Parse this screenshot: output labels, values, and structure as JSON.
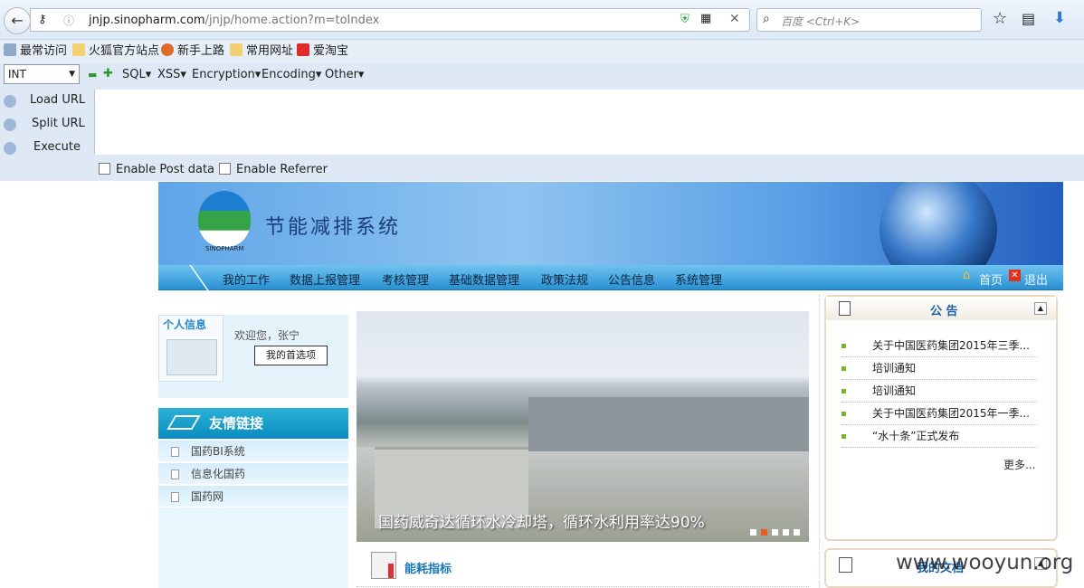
{
  "browser": {
    "url_host": "jnjp.sinopharm.com",
    "url_path": "/jnjp/home.action?m=toIndex",
    "search_placeholder": "百度 <Ctrl+K>",
    "bookmarks": [
      "最常访问",
      "火狐官方站点",
      "新手上路",
      "常用网址",
      "爱淘宝"
    ]
  },
  "hackbar": {
    "type_select": "INT",
    "menus": [
      "SQL▾",
      "XSS▾",
      "Encryption▾",
      "Encoding▾",
      "Other▾"
    ],
    "actions": [
      "Load URL",
      "Split URL",
      "Execute"
    ],
    "checkboxes": [
      "Enable Post data",
      "Enable Referrer"
    ]
  },
  "site": {
    "title": "节能减排系统",
    "logo_text": "SINOPHARM",
    "nav": [
      "我的工作",
      "数据上报管理",
      "考核管理",
      "基础数据管理",
      "政策法规",
      "公告信息",
      "系统管理"
    ],
    "home": "首页",
    "logout": "退出"
  },
  "profile": {
    "header": "个人信息",
    "welcome": "欢迎您，张宁",
    "pref_button": "我的首选项"
  },
  "links": {
    "header": "友情链接",
    "items": [
      "国药BI系统",
      "信息化国药",
      "国药网"
    ]
  },
  "slideshow": {
    "caption": "国药威奇达循环水冷却塔，循环水利用率达90%",
    "dots": 5,
    "active_dot": 2
  },
  "energy": {
    "title": "能耗指标"
  },
  "notice": {
    "title": "公 告",
    "items": [
      "关于中国医药集团2015年三季...",
      "培训通知",
      "培训通知",
      "关于中国医药集团2015年一季...",
      "“水十条”正式发布"
    ],
    "more": "更多..."
  },
  "mydoc": {
    "title": "我的文档"
  },
  "watermark": "www.wooyun.org"
}
